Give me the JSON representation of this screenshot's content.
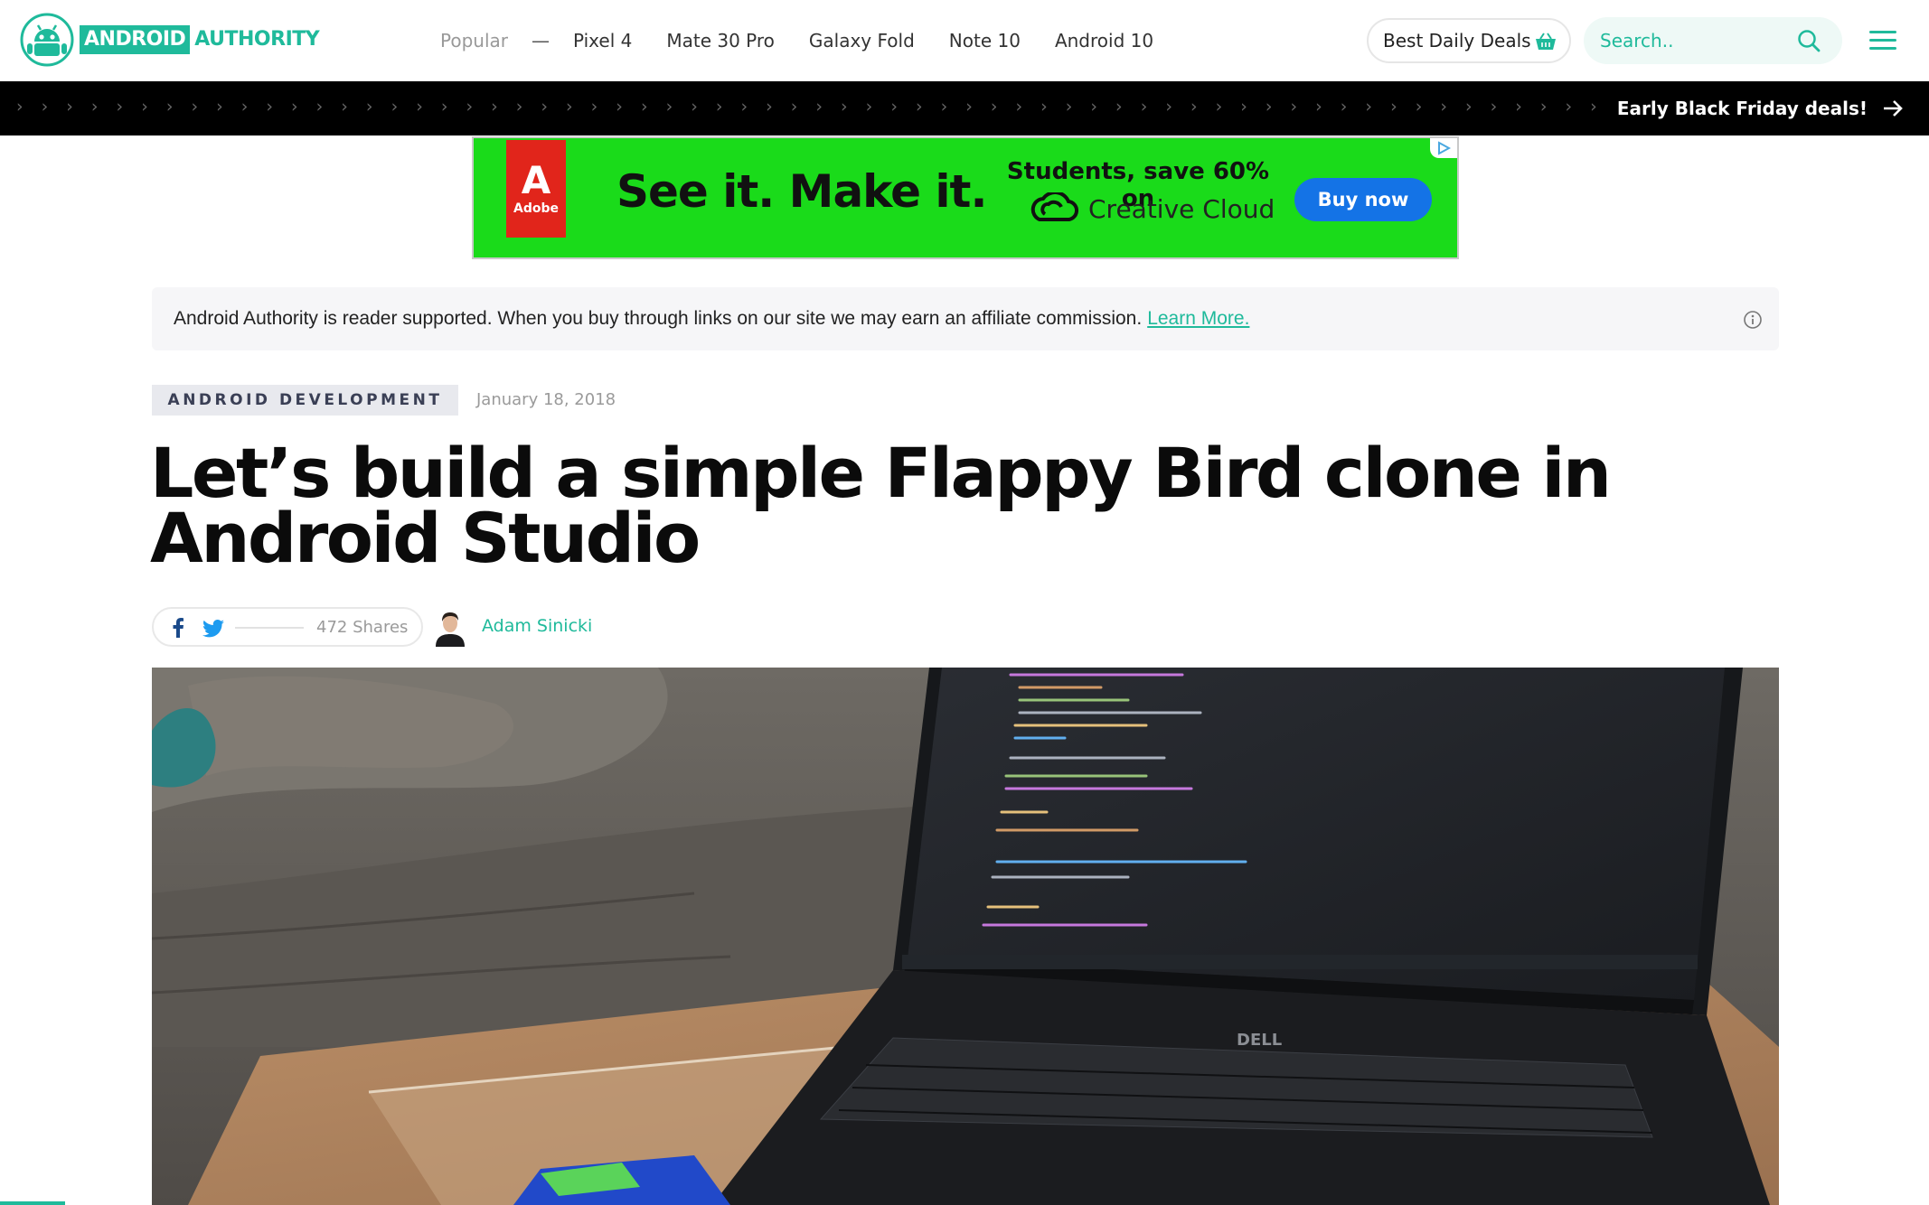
{
  "header": {
    "logo": {
      "word1": "ANDROID",
      "word2": "AUTHORITY"
    },
    "nav": {
      "popular_label": "Popular",
      "separator": "—",
      "items": [
        "Pixel 4",
        "Mate 30 Pro",
        "Galaxy Fold",
        "Note 10",
        "Android 10"
      ]
    },
    "deals_label": "Best Daily Deals",
    "search_placeholder": "Search..",
    "menu_icon": "hamburger-menu-icon"
  },
  "promo_bar": {
    "chevrons": "› › › › › › › › › › › › › › › › › › › › › › › › › › › › › › › › › › › › › › › › › › › › › › › › › › › › › › › › › › › › › › › › › › › › › › › › › › › › › › › › › › › › › › › ›",
    "link_label": "Early Black Friday deals!"
  },
  "ad": {
    "brand_letter": "A",
    "brand": "Adobe",
    "headline": "See it. Make it.",
    "subhead": "Students, save 60% on",
    "product": "Creative Cloud",
    "cta": "Buy now"
  },
  "disclosure": {
    "text": "Android Authority is reader supported. When you buy through links on our site we may earn an affiliate commission.",
    "link": "Learn More."
  },
  "article": {
    "category": "ANDROID DEVELOPMENT",
    "date": "January 18, 2018",
    "title": "Let’s build a simple Flappy Bird clone in Android Studio",
    "shares": "472 Shares",
    "author": "Adam Sinicki"
  },
  "colors": {
    "accent": "#1fba9b",
    "promo_bar": "#000000",
    "ad_background": "#1adb1a",
    "ad_button": "#1473e6",
    "adobe_red": "#e1251b"
  }
}
